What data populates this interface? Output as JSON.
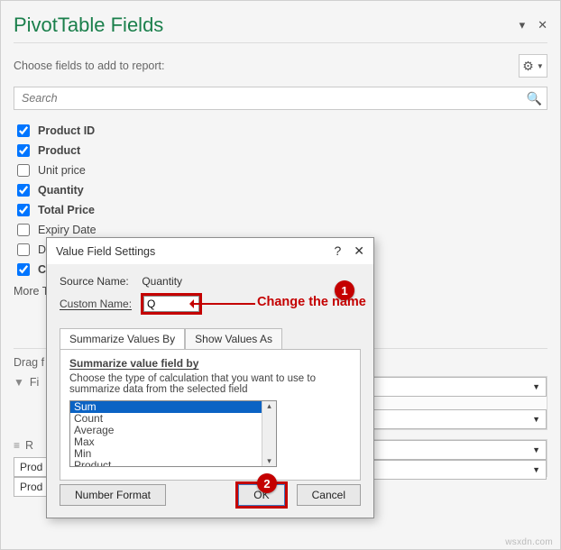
{
  "pane": {
    "title": "PivotTable Fields",
    "subtext": "Choose fields to add to report:",
    "search_placeholder": "Search",
    "more": "More T",
    "drag_label": "Drag f",
    "fields": [
      {
        "label": "Product ID",
        "checked": true,
        "bold": true
      },
      {
        "label": "Product",
        "checked": true,
        "bold": true
      },
      {
        "label": "Unit price",
        "checked": false,
        "bold": false
      },
      {
        "label": "Quantity",
        "checked": true,
        "bold": true
      },
      {
        "label": "Total Price",
        "checked": true,
        "bold": true
      },
      {
        "label": "Expiry Date",
        "checked": false,
        "bold": false
      },
      {
        "label": "Due Time",
        "checked": false,
        "bold": false
      },
      {
        "label": "Co",
        "checked": true,
        "bold": true
      }
    ],
    "areas": {
      "filters": {
        "head": "Fi"
      },
      "rows": {
        "head": "R",
        "pills": [
          "Prod",
          "Prod"
        ]
      }
    }
  },
  "dialog": {
    "title": "Value Field Settings",
    "source_label": "Source Name:",
    "source_value": "Quantity",
    "custom_label": "Custom Name:",
    "custom_value": "Q",
    "tabs": {
      "summary": "Summarize Values By",
      "show": "Show Values As"
    },
    "panel": {
      "lead": "Summarize value field by",
      "help": "Choose the type of calculation that you want to use to summarize data from the selected field",
      "options": [
        "Sum",
        "Count",
        "Average",
        "Max",
        "Min",
        "Product"
      ]
    },
    "buttons": {
      "nf": "Number Format",
      "ok": "OK",
      "cancel": "Cancel"
    }
  },
  "ann": {
    "text": "Change the name",
    "n1": "1",
    "n2": "2"
  },
  "watermark": "wsxdn.com"
}
